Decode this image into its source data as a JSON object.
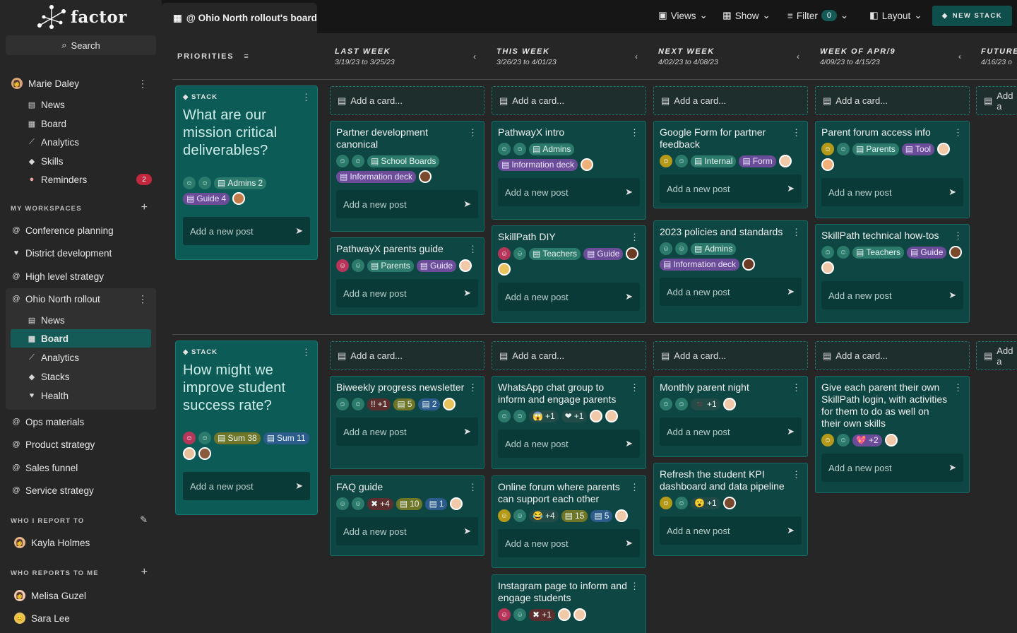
{
  "app": {
    "logo_text": "factor",
    "search_label": "Search"
  },
  "sidebar": {
    "user": {
      "name": "Marie Daley",
      "items": [
        {
          "icon": "news-icon",
          "glyph": "▤",
          "label": "News"
        },
        {
          "icon": "board-icon",
          "glyph": "▦",
          "label": "Board"
        },
        {
          "icon": "analytics-icon",
          "glyph": "⟋",
          "label": "Analytics"
        },
        {
          "icon": "skills-icon",
          "glyph": "◆",
          "label": "Skills"
        },
        {
          "icon": "bell-icon",
          "glyph": "●",
          "label": "Reminders",
          "badge": "2"
        }
      ]
    },
    "workspaces_header": "MY WORKSPACES",
    "workspaces": [
      "Conference planning",
      "District development",
      "High level strategy"
    ],
    "active_workspace": {
      "name": "Ohio North rollout",
      "items": [
        {
          "icon": "news-icon",
          "glyph": "▤",
          "label": "News"
        },
        {
          "icon": "board-icon",
          "glyph": "▦",
          "label": "Board"
        },
        {
          "icon": "analytics-icon",
          "glyph": "⟋",
          "label": "Analytics"
        },
        {
          "icon": "stacks-icon",
          "glyph": "◆",
          "label": "Stacks"
        },
        {
          "icon": "health-icon",
          "glyph": "♥",
          "label": "Health"
        }
      ]
    },
    "more_workspaces": [
      "Ops materials",
      "Product strategy",
      "Sales funnel",
      "Service strategy"
    ],
    "report_to_header": "WHO I REPORT TO",
    "report_to": [
      "Kayla Holmes"
    ],
    "reports_header": "WHO REPORTS TO ME",
    "reports": [
      "Melisa Guzel",
      "Sara Lee"
    ]
  },
  "topbar": {
    "board_title": "@ Ohio North rollout's board",
    "views": "Views",
    "show": "Show",
    "filter": "Filter",
    "filter_count": "0",
    "layout": "Layout",
    "new_stack": "NEW STACK"
  },
  "board": {
    "priorities_label": "PRIORITIES",
    "columns": [
      {
        "title": "LAST WEEK",
        "dates": "3/19/23 to 3/25/23"
      },
      {
        "title": "THIS WEEK",
        "dates": "3/26/23 to 4/01/23"
      },
      {
        "title": "NEXT WEEK",
        "dates": "4/02/23 to 4/08/23"
      },
      {
        "title": "WEEK OF APR/9",
        "dates": "4/09/23 to 4/15/23"
      },
      {
        "title": "FUTURE",
        "dates": "4/16/23 o"
      }
    ],
    "add_card": "Add a card...",
    "add_card_cut": "Add a",
    "add_post": "Add a new post",
    "stack_label": "STACK",
    "stacks": [
      {
        "title": "What are our mission critical deliverables?",
        "tags": [
          {
            "t": "Admins",
            "n": "2"
          },
          {
            "t": "Guide",
            "n": "4"
          }
        ]
      },
      {
        "title": "How might we improve student success rate?",
        "tags": [
          {
            "t": "Sum 38"
          },
          {
            "t": "Sum 11"
          }
        ]
      }
    ],
    "cards": {
      "c1": {
        "title": "Partner development canonical",
        "tags": [
          "School Boards",
          "Information deck"
        ]
      },
      "c2": {
        "title": "PathwayX parents guide",
        "tags": [
          "Parents",
          "Guide"
        ]
      },
      "c3": {
        "title": "PathwayX intro",
        "tags": [
          "Admins",
          "Information deck"
        ]
      },
      "c4": {
        "title": "SkillPath DIY",
        "tags": [
          "Teachers",
          "Guide"
        ]
      },
      "c5": {
        "title": "Google Form for partner feedback",
        "tags": [
          "Internal",
          "Form"
        ]
      },
      "c6": {
        "title": "2023 policies and standards",
        "tags": [
          "Admins",
          "Information deck"
        ]
      },
      "c7": {
        "title": "Parent forum access info",
        "tags": [
          "Parents",
          "Tool"
        ]
      },
      "c8": {
        "title": "SkillPath technical how-tos",
        "tags": [
          "Teachers",
          "Guide"
        ]
      },
      "d1": {
        "title": "Biweekly progress newsletter",
        "tags": [
          "+1",
          "5",
          "2"
        ]
      },
      "d2": {
        "title": "FAQ guide",
        "tags": [
          "+4",
          "10",
          "1"
        ]
      },
      "d3": {
        "title": "WhatsApp chat group to inform and engage parents",
        "tags": [
          "+1",
          "+1"
        ]
      },
      "d4": {
        "title": "Online forum where parents can support each other",
        "tags": [
          "+4",
          "15",
          "5"
        ]
      },
      "d5": {
        "title": "Instagram page to inform and engage students",
        "tags": [
          "+1"
        ]
      },
      "d6": {
        "title": "Monthly parent night",
        "tags": [
          "+1"
        ]
      },
      "d7": {
        "title": "Refresh the student KPI dashboard and data pipeline",
        "tags": [
          "+1"
        ]
      },
      "d8": {
        "title": "Give each parent their own SkillPath login, with activities for them to do as well on their own skills",
        "tags": [
          "+2"
        ]
      }
    }
  },
  "colors": {
    "accent": "#145a56",
    "card": "#0d4642",
    "stack": "#0d5b57",
    "badge": "#c2273d"
  }
}
